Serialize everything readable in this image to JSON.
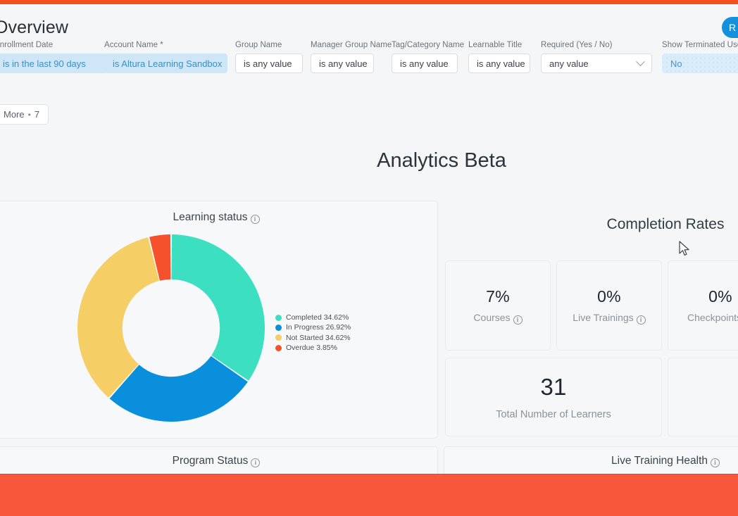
{
  "theme": {
    "accent_bar": "#f4501f",
    "bottom_bar": "#f9573c",
    "primary_button": "#1391dd",
    "background": "#f5f6f8"
  },
  "header": {
    "title": "Overview",
    "run_button_label": "R"
  },
  "filters": {
    "items": [
      {
        "label": "Enrollment Date",
        "value": "is in the last 90 days",
        "style": "active"
      },
      {
        "label": "Account Name *",
        "value": "is Altura Learning Sandbox",
        "style": "active"
      },
      {
        "label": "Group Name",
        "value": "is any value",
        "style": "plain"
      },
      {
        "label": "Manager Group Name",
        "value": "is any value",
        "style": "plain"
      },
      {
        "label": "Tag/Category Name",
        "value": "is any value",
        "style": "plain"
      },
      {
        "label": "Learnable Title",
        "value": "is any value",
        "style": "plain"
      },
      {
        "label": "Required (Yes / No)",
        "value": "any value",
        "style": "select"
      },
      {
        "label": "Show Terminated Users",
        "value": "No",
        "style": "dotted"
      }
    ],
    "more_button": {
      "text": "More",
      "separator": "•",
      "count": "7"
    }
  },
  "dashboard": {
    "title": "Analytics Beta",
    "learning_status": {
      "title": "Learning status",
      "info_icon": "info-icon"
    },
    "completion_rates": {
      "title": "Completion Rates",
      "cards": [
        {
          "value": "7%",
          "label": "Courses",
          "info": true
        },
        {
          "value": "0%",
          "label": "Live Trainings",
          "info": true
        },
        {
          "value": "0%",
          "label": "Checkpoints",
          "info": true
        }
      ],
      "wide_cards": [
        {
          "value": "31",
          "label": "Total Number of Learners"
        }
      ]
    },
    "bottom_panels": [
      {
        "title": "Program Status"
      },
      {
        "title": "Live Training Health"
      }
    ]
  },
  "chart_data": {
    "type": "pie",
    "title": "Learning status",
    "subtype": "donut",
    "legend_position": "right",
    "categories": [
      "Completed",
      "In Progress",
      "Not Started",
      "Overdue"
    ],
    "values": [
      34.62,
      26.92,
      34.62,
      3.85
    ],
    "value_suffix": "%",
    "colors": [
      "#3ddfc1",
      "#0a8fdc",
      "#f5ce66",
      "#f4512c"
    ],
    "labels": [
      "Completed 34.62%",
      "In Progress 26.92%",
      "Not Started 34.62%",
      "Overdue 3.85%"
    ],
    "start_angle": 0,
    "direction": "clockwise",
    "inner_radius_ratio": 0.52
  }
}
